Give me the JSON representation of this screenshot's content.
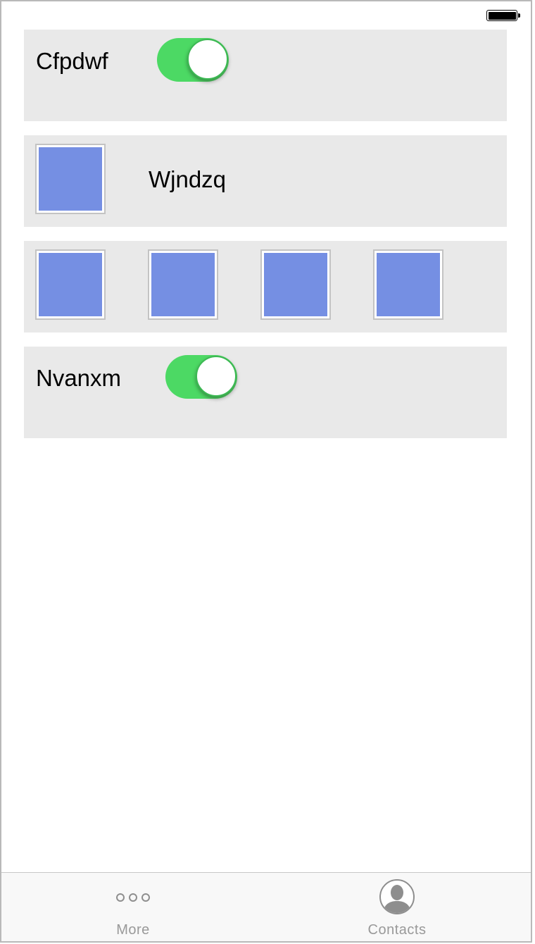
{
  "status_bar": {
    "battery_icon": "battery-full-icon"
  },
  "rows": [
    {
      "type": "toggle",
      "label": "Cfpdwf",
      "toggle_on": true
    },
    {
      "type": "image-label",
      "label": "Wjndzq",
      "image_icon": "image-placeholder"
    },
    {
      "type": "image-grid",
      "images": [
        "image-placeholder",
        "image-placeholder",
        "image-placeholder",
        "image-placeholder"
      ]
    },
    {
      "type": "toggle",
      "label": "Nvanxm",
      "toggle_on": true
    }
  ],
  "colors": {
    "toggle_on": "#4cd964",
    "image_fill": "#758fe3",
    "card_background": "#e9e9e9",
    "tab_label": "#999999"
  },
  "tab_bar": {
    "tabs": [
      {
        "label": "More",
        "icon": "more-dots-icon"
      },
      {
        "label": "Contacts",
        "icon": "contacts-icon"
      }
    ]
  }
}
